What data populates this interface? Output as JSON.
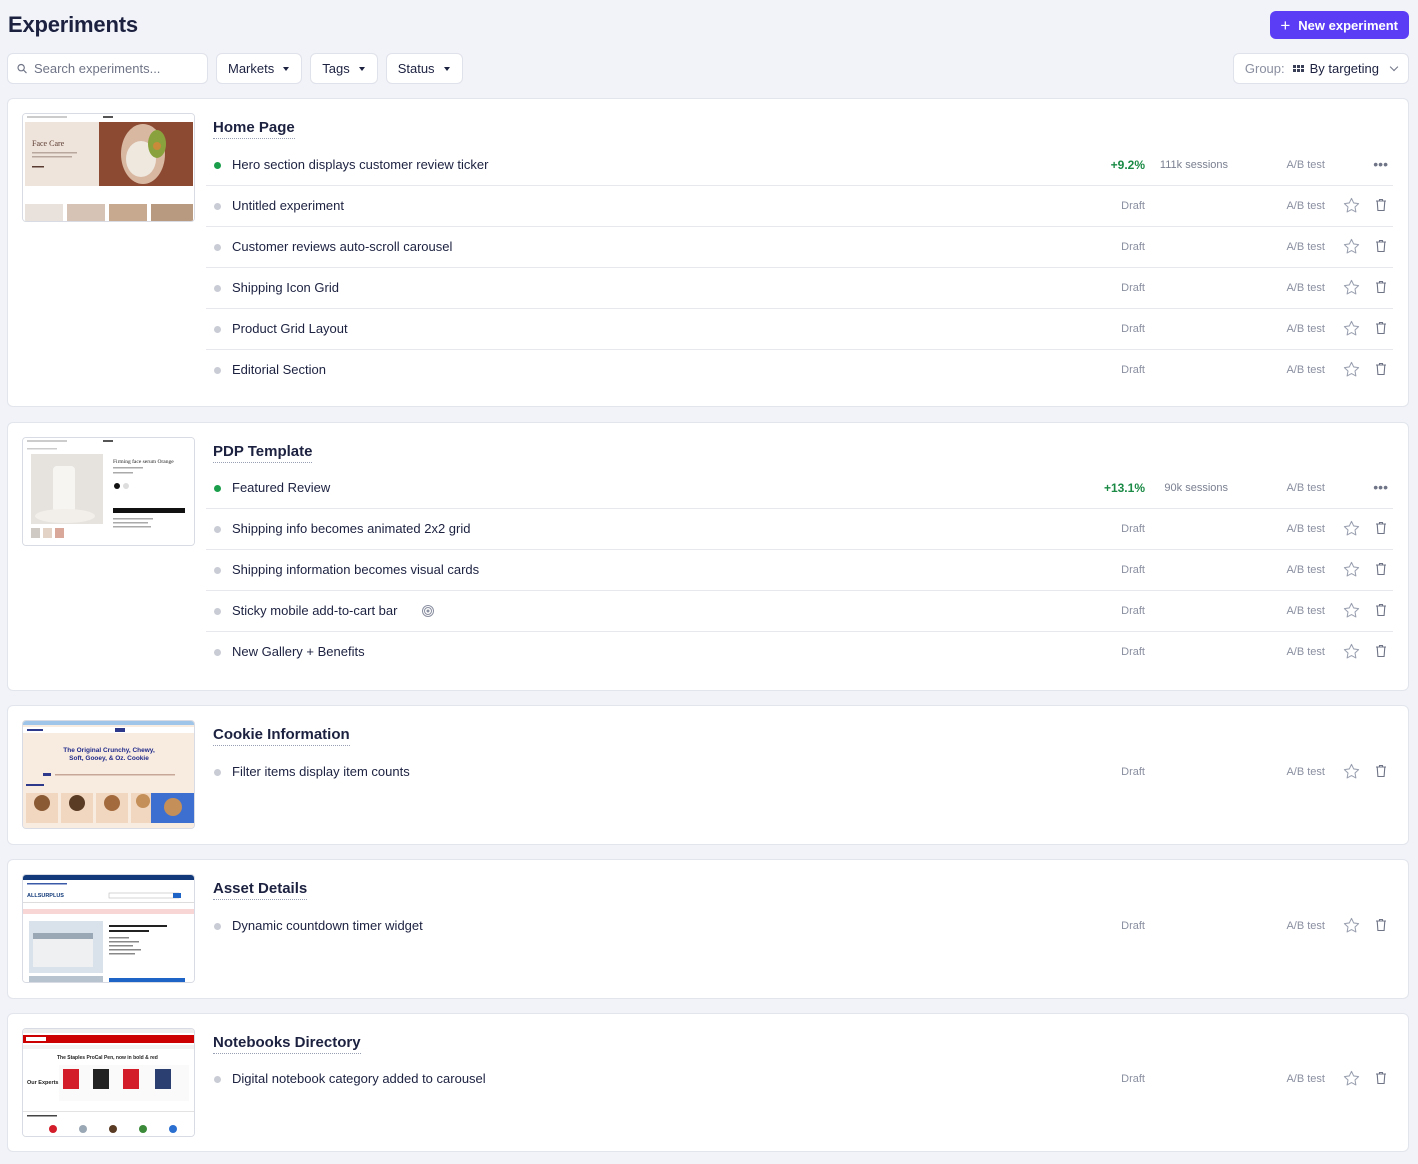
{
  "header": {
    "title": "Experiments",
    "new_button_label": "New experiment"
  },
  "toolbar": {
    "search_placeholder": "Search experiments...",
    "filters": [
      "Markets",
      "Tags",
      "Status"
    ],
    "group_label": "Group:",
    "group_value": "By targeting"
  },
  "colors": {
    "accent": "#5b3df5",
    "live": "#1a9e4b",
    "lift": "#1a8a45"
  },
  "groups": [
    {
      "title": "Home Page",
      "experiments": [
        {
          "name": "Hero section displays customer review ticker",
          "status": "live",
          "lift": "+9.2%",
          "sessions": "111k sessions",
          "type": "A/B test"
        },
        {
          "name": "Untitled experiment",
          "status": "Draft",
          "type": "A/B test"
        },
        {
          "name": "Customer reviews auto-scroll carousel",
          "status": "Draft",
          "type": "A/B test"
        },
        {
          "name": "Shipping Icon Grid",
          "status": "Draft",
          "type": "A/B test"
        },
        {
          "name": "Product Grid Layout",
          "status": "Draft",
          "type": "A/B test"
        },
        {
          "name": "Editorial Section",
          "status": "Draft",
          "type": "A/B test"
        }
      ]
    },
    {
      "title": "PDP Template",
      "experiments": [
        {
          "name": "Featured Review",
          "status": "live",
          "lift": "+13.1%",
          "sessions": "90k sessions",
          "type": "A/B test"
        },
        {
          "name": "Shipping info becomes animated 2x2 grid",
          "status": "Draft",
          "type": "A/B test"
        },
        {
          "name": "Shipping information becomes visual cards",
          "status": "Draft",
          "type": "A/B test"
        },
        {
          "name": "Sticky mobile add-to-cart bar",
          "status": "Draft",
          "type": "A/B test",
          "icon": "target-icon"
        },
        {
          "name": "New Gallery + Benefits",
          "status": "Draft",
          "type": "A/B test"
        }
      ]
    },
    {
      "title": "Cookie Information",
      "experiments": [
        {
          "name": "Filter items display item counts",
          "status": "Draft",
          "type": "A/B test"
        }
      ]
    },
    {
      "title": "Asset Details",
      "experiments": [
        {
          "name": "Dynamic countdown timer widget",
          "status": "Draft",
          "type": "A/B test"
        }
      ]
    },
    {
      "title": "Notebooks Directory",
      "experiments": [
        {
          "name": "Digital notebook category added to carousel",
          "status": "Draft",
          "type": "A/B test"
        }
      ]
    }
  ],
  "thumbnails": {
    "home": {
      "heading": "Face Care"
    },
    "pdp": {
      "heading": "Firming face serum Orange"
    },
    "cookie": {
      "line1": "The Original Crunchy, Chewy,",
      "line2": "Soft, Gooey, & Oz. Cookie"
    },
    "asset": {
      "brand": "ALLSURPLUS"
    },
    "notebooks": {
      "headline": "The Staples ProCal Pen, now in bold & red",
      "callout": "Our Experts Suggest"
    }
  }
}
